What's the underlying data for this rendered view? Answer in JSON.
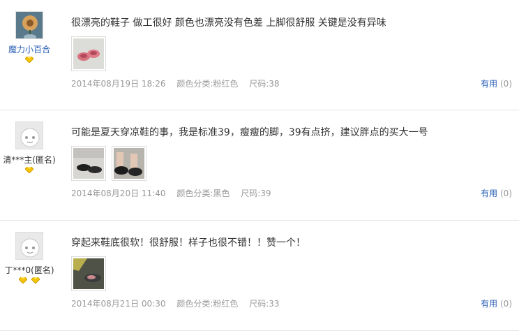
{
  "reviews": [
    {
      "user": "魔力小百合",
      "badge_count": 1,
      "text": "很漂亮的鞋子 做工很好 颜色也漂亮没有色差 上脚很舒服 关键是没有异味",
      "date": "2014年08月19日 18:26",
      "color": "颜色分类:粉红色",
      "size": "尺码:38",
      "useful_label": "有用",
      "useful_count": "(0)"
    },
    {
      "user": "清***主(匿名)",
      "badge_count": 1,
      "text": "可能是夏天穿凉鞋的事，我是标准39，瘦瘦的脚，39有点挤，建议胖点的买大一号",
      "date": "2014年08月20日 11:40",
      "color": "颜色分类:黑色",
      "size": "尺码:39",
      "useful_label": "有用",
      "useful_count": "(0)"
    },
    {
      "user": "丁***0(匿名)",
      "badge_count": 2,
      "text": "穿起来鞋底很软！很舒服！样子也很不错！！赞一个！",
      "date": "2014年08月21日 00:30",
      "color": "颜色分类:粉红色",
      "size": "尺码:33",
      "useful_label": "有用",
      "useful_count": "(0)"
    }
  ]
}
